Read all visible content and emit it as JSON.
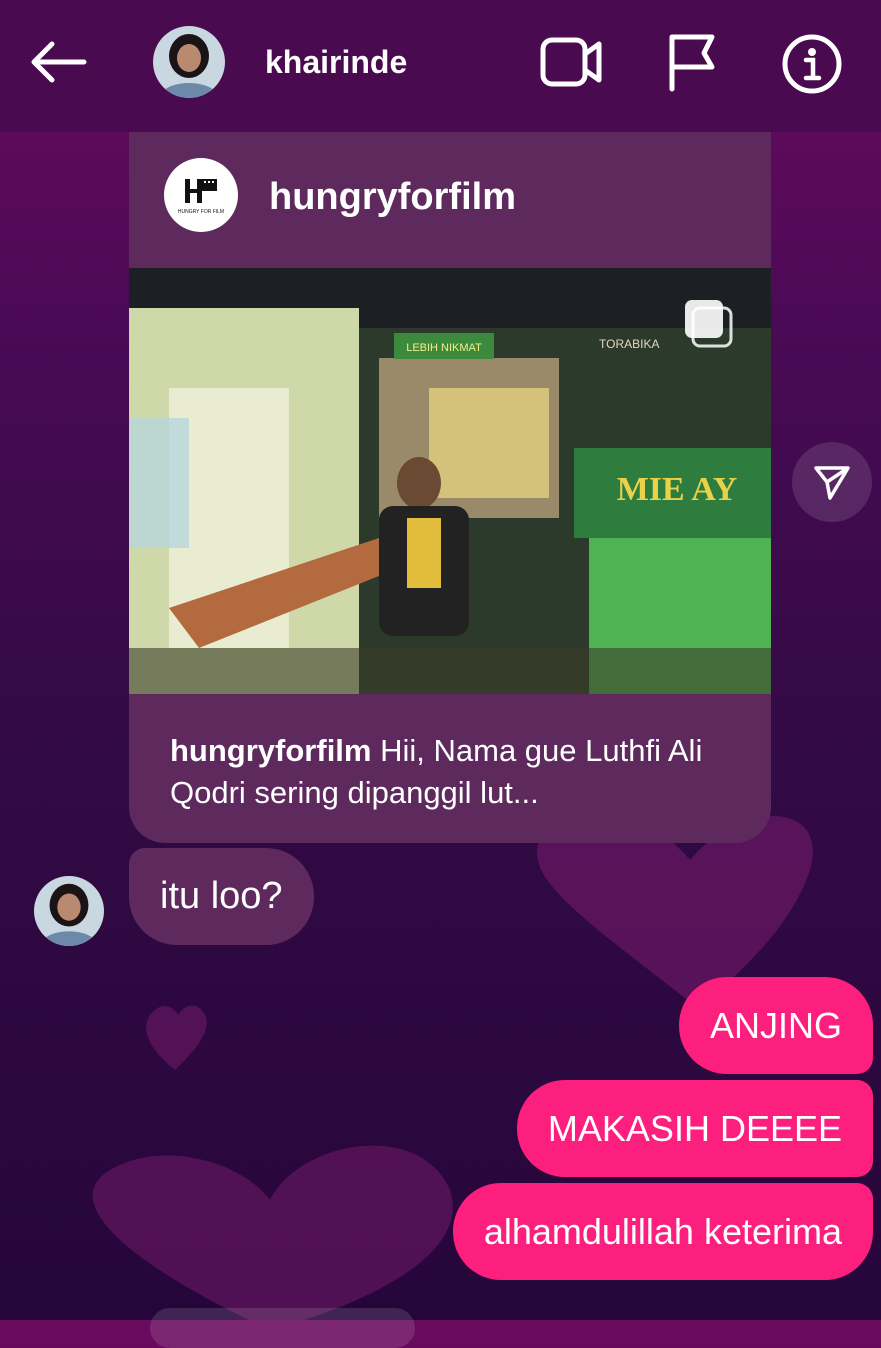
{
  "header": {
    "username": "khairinde",
    "back_icon": "arrow-left-icon",
    "video_icon": "video-call-icon",
    "flag_icon": "flag-icon",
    "info_icon": "info-icon"
  },
  "post": {
    "author": "hungryforfilm",
    "logo_text": "HUNGRY FOR FILM",
    "image_signs": [
      "LEBIH NIKMAT",
      "TORABIKA",
      "MIE AY"
    ],
    "caption_author": "hungryforfilm",
    "caption_text": " Hii, Nama gue Luthfi Ali Qodri sering dipanggil lut...",
    "multi_image_icon": "carousel-icon",
    "share_icon": "send-icon"
  },
  "messages": {
    "incoming": [
      {
        "text": "itu loo?"
      }
    ],
    "outgoing": [
      {
        "text": "ANJING"
      },
      {
        "text": "MAKASIH DEEEE"
      },
      {
        "text": "alhamdulillah keterima"
      }
    ]
  },
  "colors": {
    "topbar": "#4a0a4f",
    "incoming_bubble": "#5e2a5e",
    "outgoing_bubble": "#fc1f7e"
  }
}
